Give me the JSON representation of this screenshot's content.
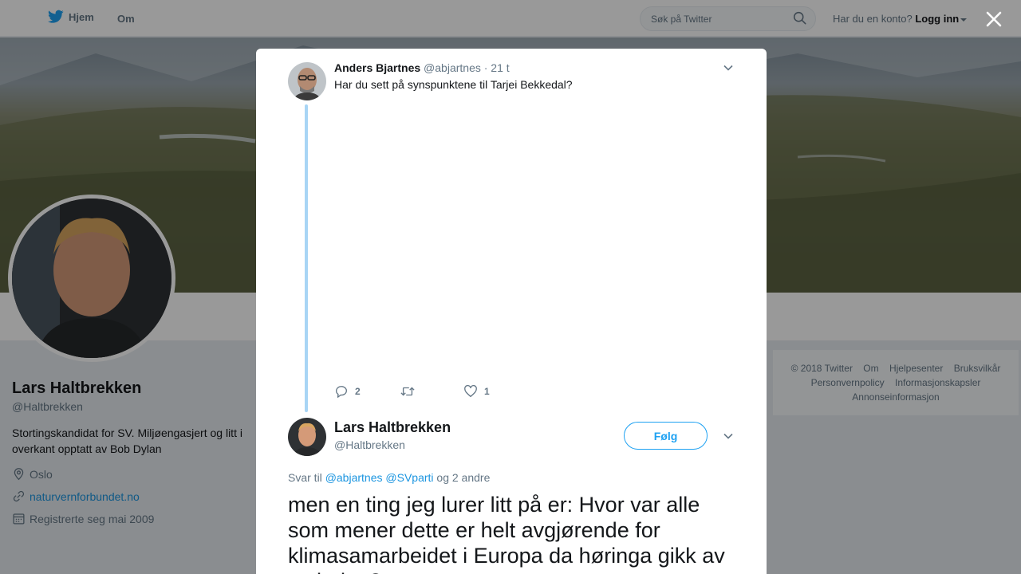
{
  "nav": {
    "home_label": "Hjem",
    "about_label": "Om",
    "search_placeholder": "Søk på Twitter",
    "account_prompt": "Har du en konto?",
    "login_label": "Logg inn"
  },
  "profile": {
    "name": "Lars Haltbrekken",
    "handle": "@Haltbrekken",
    "bio": "Stortingskandidat for SV. Miljøengasjert og litt i overkant opptatt av Bob Dylan",
    "location": "Oslo",
    "website": "naturvernforbundet.no",
    "joined": "Registrerte seg mai 2009"
  },
  "footer": {
    "copyright": "© 2018 Twitter",
    "links": [
      "Om",
      "Hjelpesenter",
      "Bruksvilkår",
      "Personvernpolicy",
      "Informasjonskapsler",
      "Annonseinformasjon"
    ]
  },
  "modal": {
    "parent_tweet": {
      "name": "Anders Bjartnes",
      "handle": "@abjartnes",
      "time": "· 21 t",
      "text": "Har du sett på synspunktene til Tarjei Bekkedal?",
      "reply_count": "2",
      "like_count": "1"
    },
    "main_tweet": {
      "name": "Lars Haltbrekken",
      "handle": "@Haltbrekken",
      "follow_label": "Følg",
      "reply_prefix": "Svar til",
      "reply_mention_1": "@abjartnes",
      "reply_mention_2": "@SVparti",
      "reply_suffix": "og 2 andre",
      "text": "men en ting jeg lurer litt på er: Hvor var alle som mener dette er helt avgjørende for klimasamarbeidet i Europa da høringa gikk av stabelen?"
    }
  },
  "colors": {
    "accent": "#1da1f2",
    "link": "#1b95e0",
    "thread_line": "#a8d5f5",
    "secondary_text": "#657786"
  }
}
